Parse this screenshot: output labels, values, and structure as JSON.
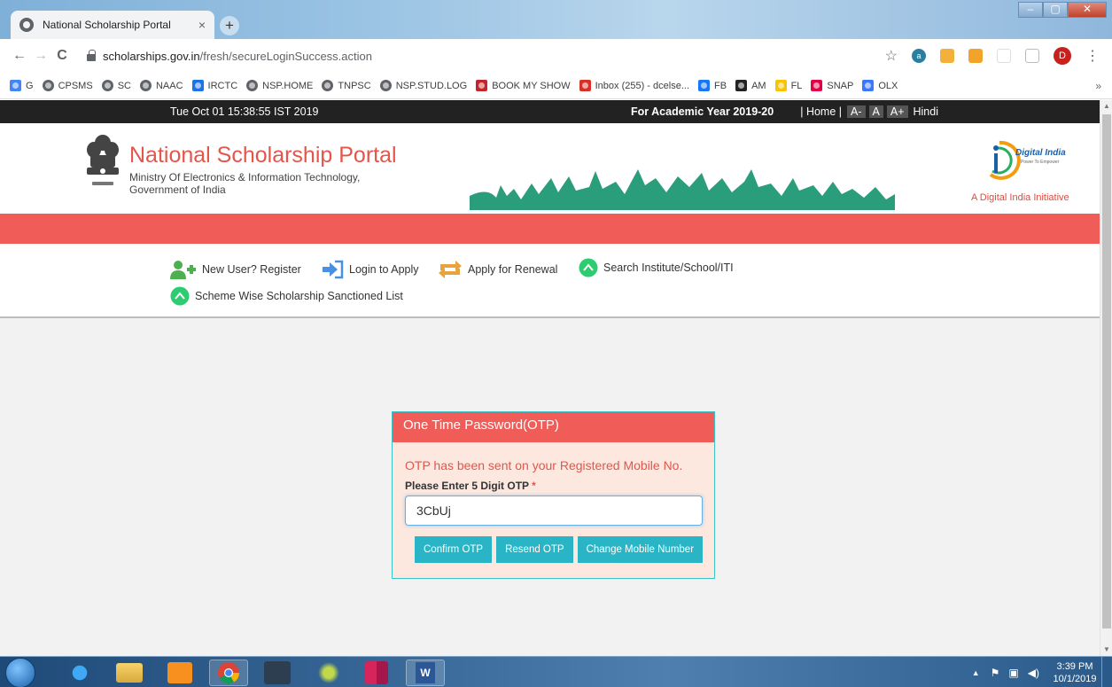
{
  "browser": {
    "tab_title": "National Scholarship Portal",
    "tab_close": "×",
    "new_tab": "+",
    "url_host": "scholarships.gov.in",
    "url_path": "/fresh/secureLoginSuccess.action",
    "nav": {
      "back": "←",
      "forward": "→",
      "reload": "C"
    },
    "star": "☆",
    "more": "⋮",
    "avatar_initial": "D"
  },
  "bookmarks": [
    {
      "label": "G",
      "icon": "google-icon",
      "color": "#4285f4"
    },
    {
      "label": "CPSMS",
      "icon": "globe-icon",
      "color": "#5f6368"
    },
    {
      "label": "SC",
      "icon": "globe-icon",
      "color": "#5f6368"
    },
    {
      "label": "NAAC",
      "icon": "globe-icon",
      "color": "#5f6368"
    },
    {
      "label": "IRCTC",
      "icon": "irctc-icon",
      "color": "#1a73e8"
    },
    {
      "label": "NSP.HOME",
      "icon": "globe-icon",
      "color": "#5f6368"
    },
    {
      "label": "TNPSC",
      "icon": "globe-icon",
      "color": "#5f6368"
    },
    {
      "label": "NSP.STUD.LOG",
      "icon": "globe-icon",
      "color": "#5f6368"
    },
    {
      "label": "BOOK MY SHOW",
      "icon": "bookmyshow-icon",
      "color": "#c4242b"
    },
    {
      "label": "Inbox (255) - dcelse...",
      "icon": "gmail-icon",
      "color": "#d93025"
    },
    {
      "label": "FB",
      "icon": "facebook-icon",
      "color": "#1877f2"
    },
    {
      "label": "AM",
      "icon": "amazon-icon",
      "color": "#222"
    },
    {
      "label": "FL",
      "icon": "flipkart-icon",
      "color": "#f8c400"
    },
    {
      "label": "SNAP",
      "icon": "snapdeal-icon",
      "color": "#e40046"
    },
    {
      "label": "OLX",
      "icon": "olx-icon",
      "color": "#3a77ff"
    }
  ],
  "bookmarks_more": "»",
  "portal": {
    "datetime": "Tue Oct 01 15:38:55 IST 2019",
    "academic_year": "For Academic Year 2019-20",
    "links": [
      "| Home |",
      "A-",
      "A",
      "A+",
      "Hindi"
    ],
    "title": "National Scholarship Portal",
    "subtitle_line1": "Ministry Of Electronics & Information Technology,",
    "subtitle_line2": "Government of India",
    "digital_india": "A Digital India Initiative",
    "digital_india_logo": "Digital India",
    "digital_india_tag": "Power To Empower",
    "menu": [
      {
        "label": "New User? Register",
        "icon": "add-user-icon"
      },
      {
        "label": "Login to Apply",
        "icon": "login-icon"
      },
      {
        "label": "Apply for Renewal",
        "icon": "renewal-icon"
      },
      {
        "label": "Search Institute/School/ITI",
        "icon": "chevron-up-circle-icon"
      },
      {
        "label": "Scheme Wise Scholarship Sanctioned List",
        "icon": "chevron-up-circle-icon"
      }
    ]
  },
  "otp": {
    "heading": "One Time Password(OTP)",
    "message": "OTP has been sent on your Registered Mobile No.",
    "label": "Please Enter 5 Digit OTP",
    "required_mark": "*",
    "value": "3CbUj",
    "confirm": "Confirm OTP",
    "resend": "Resend OTP",
    "change": "Change Mobile Number"
  },
  "taskbar": {
    "time": "3:39 PM",
    "date": "10/1/2019"
  },
  "colors": {
    "accent_red": "#f05c57",
    "button_teal": "#29b5c6",
    "title_red": "#e4554a"
  }
}
